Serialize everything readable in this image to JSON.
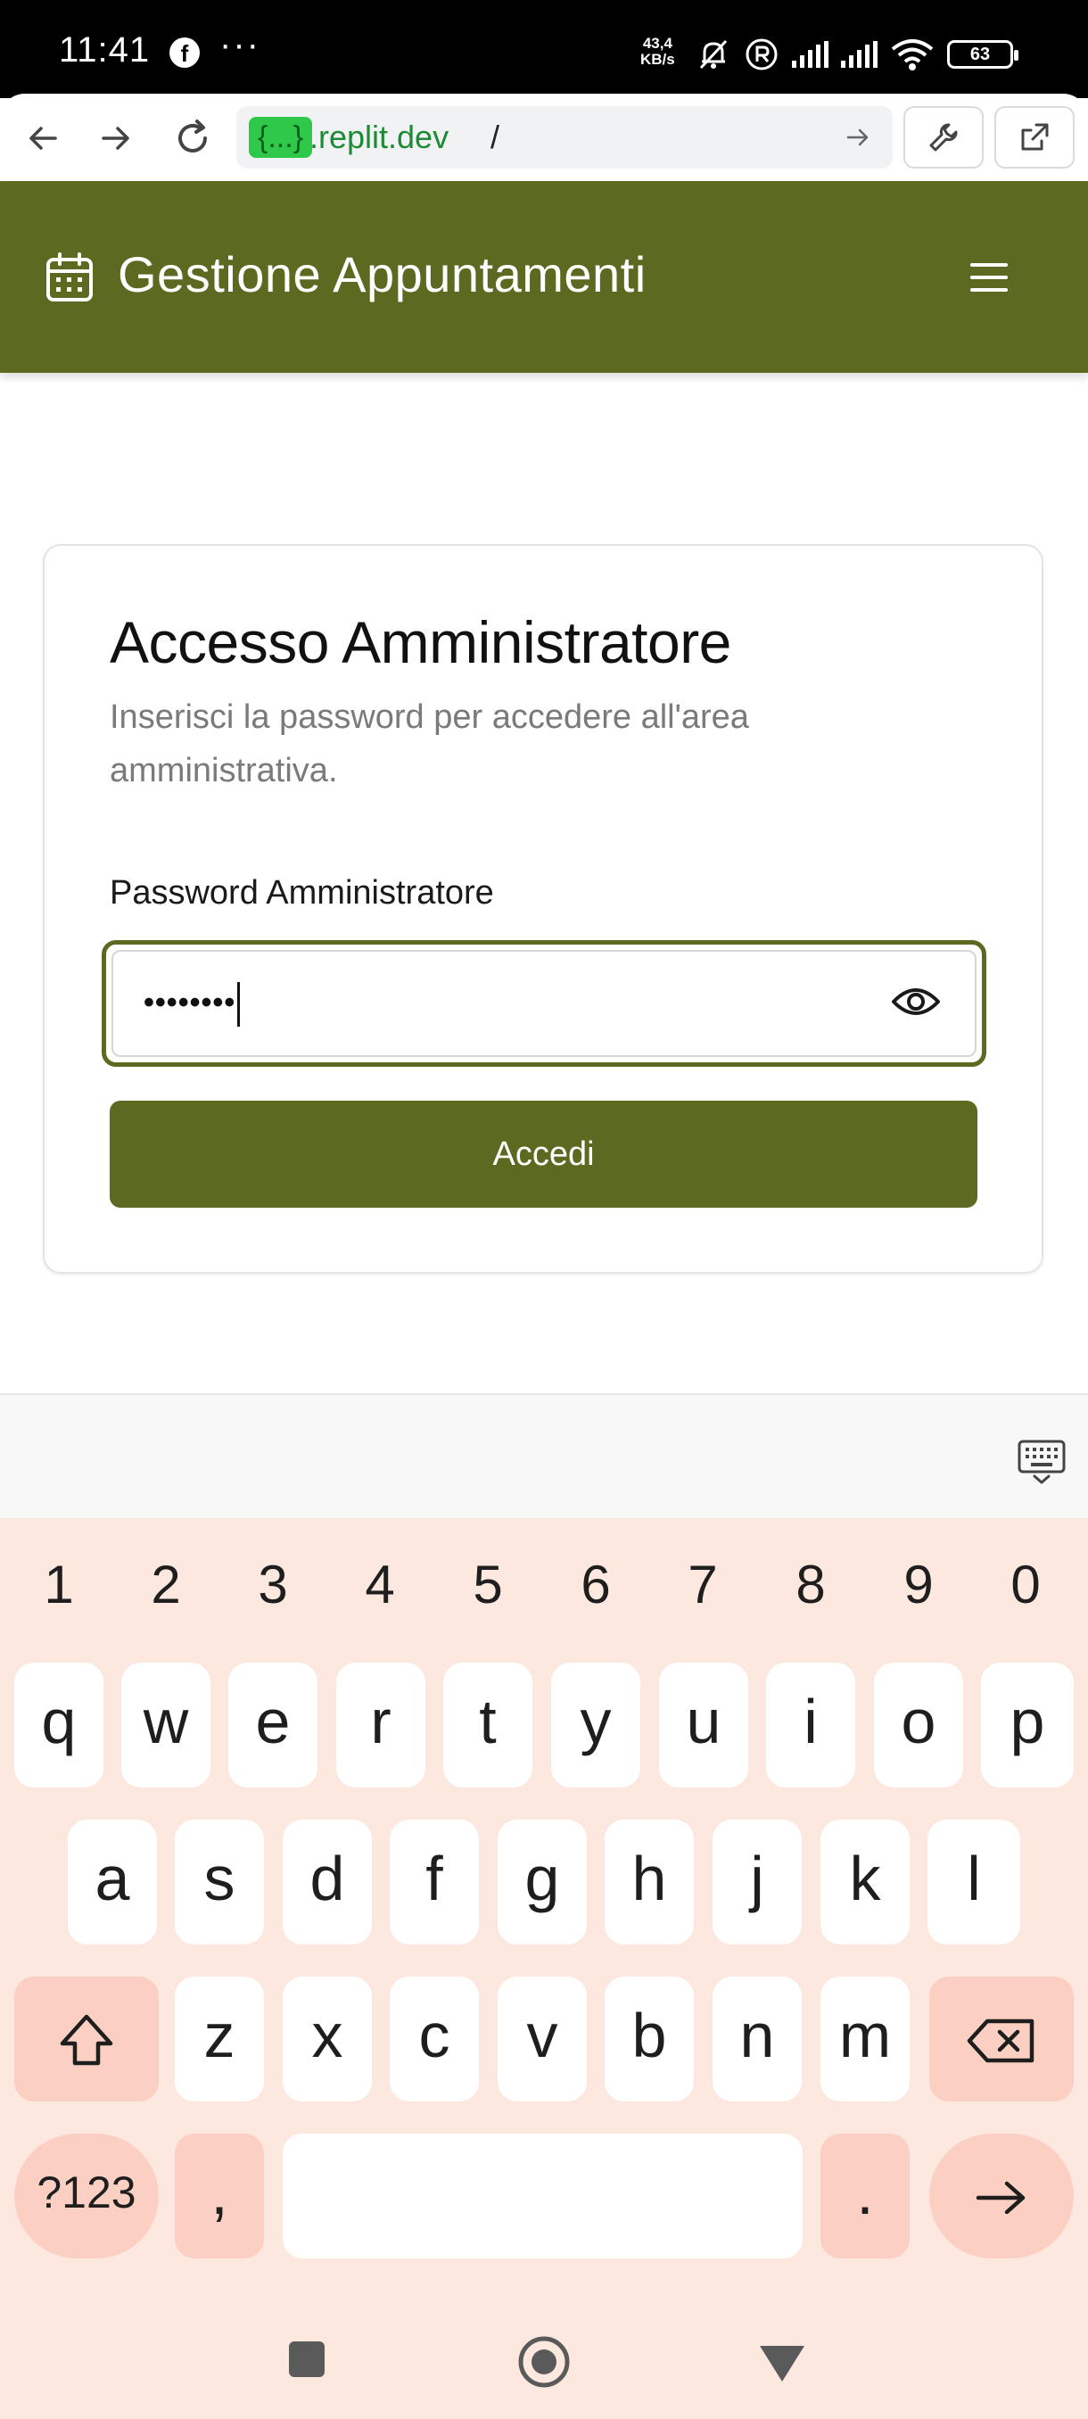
{
  "status_bar": {
    "time": "11:41",
    "facebook_glyph": "f",
    "more": "···",
    "net_speed_value": "43,4",
    "net_speed_unit": "KB/s",
    "battery": "63"
  },
  "browser": {
    "url_tag": "{...}",
    "url_domain": ".replit.dev",
    "url_path": "/"
  },
  "app": {
    "title": "Gestione Appuntamenti",
    "accent_color": "#5c6a21"
  },
  "login": {
    "title": "Accesso Amministratore",
    "subtitle": "Inserisci la password per accedere all'area amministrativa.",
    "password_label": "Password Amministratore",
    "password_value": "••••••••",
    "submit_label": "Accedi"
  },
  "keyboard": {
    "numbers": [
      "1",
      "2",
      "3",
      "4",
      "5",
      "6",
      "7",
      "8",
      "9",
      "0"
    ],
    "row1": [
      "q",
      "w",
      "e",
      "r",
      "t",
      "y",
      "u",
      "i",
      "o",
      "p"
    ],
    "row2": [
      "a",
      "s",
      "d",
      "f",
      "g",
      "h",
      "j",
      "k",
      "l"
    ],
    "row3": [
      "z",
      "x",
      "c",
      "v",
      "b",
      "n",
      "m"
    ],
    "symbols_label": "?123",
    "comma": ",",
    "period": "."
  }
}
